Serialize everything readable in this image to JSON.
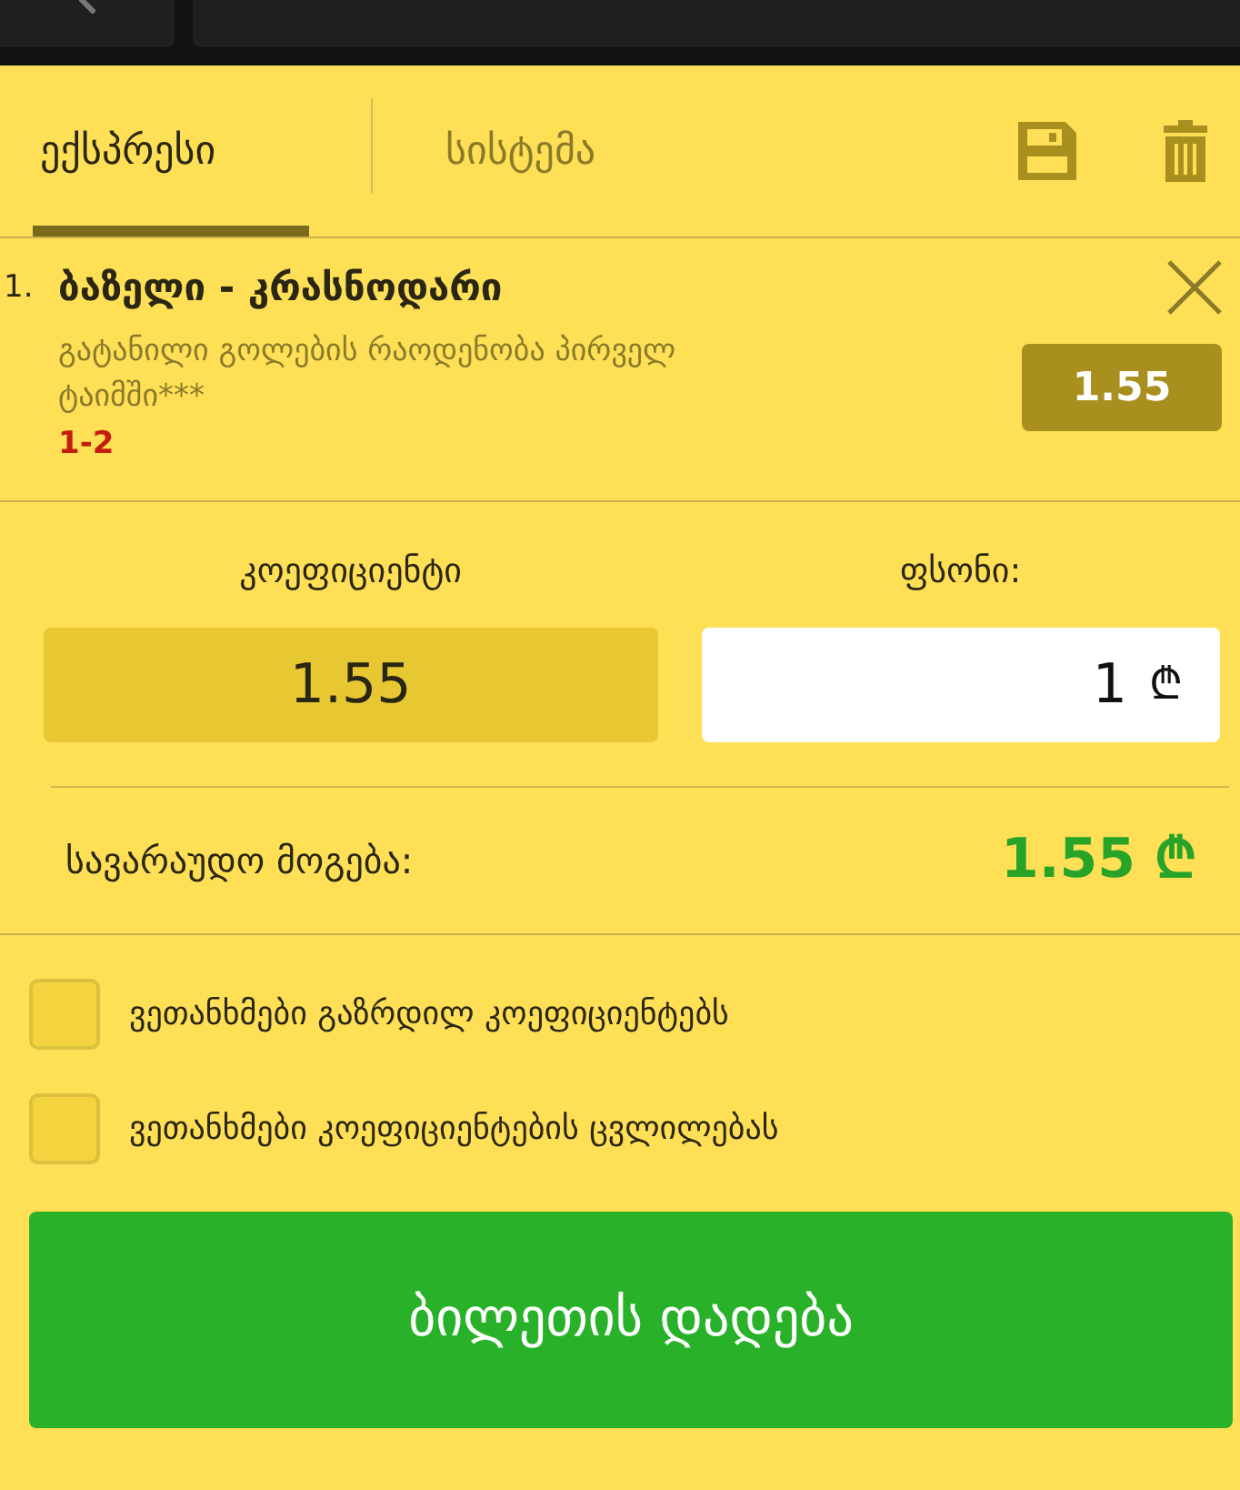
{
  "tabs": [
    {
      "label": "ექსპრესი",
      "selected": true
    },
    {
      "label": "სისტემა",
      "selected": false
    }
  ],
  "bets": [
    {
      "number": "1.",
      "match": "ბაზელი - კრასნოდარი",
      "market": "გატანილი გოლების რაოდენობა პირველ ტაიმში***",
      "pick": "1-2",
      "odds": "1.55"
    }
  ],
  "odds_label": "კოეფიციენტი",
  "odds_value": "1.55",
  "stake_label": "ფსონი:",
  "stake_value": "1",
  "currency": "₾",
  "win_label": "სავარაუდო მოგება:",
  "win_value": "1.55 ₾",
  "options": [
    {
      "label": "ვეთანხმები გაზრდილ კოეფიციენტებს",
      "checked": false
    },
    {
      "label": "ვეთანხმები კოეფიციენტების ცვლილებას",
      "checked": false
    }
  ],
  "submit": "ბილეთის დადება"
}
